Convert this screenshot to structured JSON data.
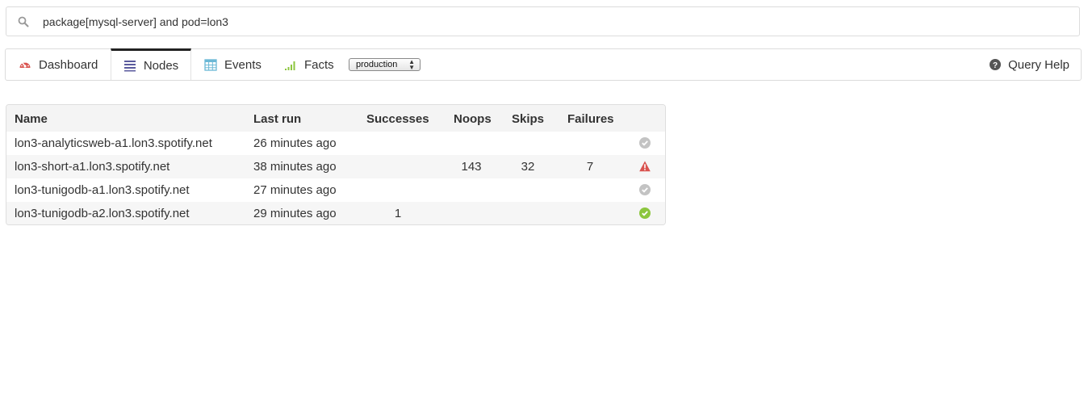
{
  "search": {
    "value": "package[mysql-server] and pod=lon3"
  },
  "nav": {
    "tabs": [
      {
        "label": "Dashboard",
        "icon": "dashboard-icon",
        "active": false
      },
      {
        "label": "Nodes",
        "icon": "list-icon",
        "active": true
      },
      {
        "label": "Events",
        "icon": "calendar-icon",
        "active": false
      },
      {
        "label": "Facts",
        "icon": "bar-chart-icon",
        "active": false
      }
    ],
    "environment": "production",
    "query_help": "Query Help"
  },
  "table": {
    "columns": [
      "Name",
      "Last run",
      "Successes",
      "Noops",
      "Skips",
      "Failures"
    ],
    "rows": [
      {
        "name": "lon3-analyticsweb-a1.lon3.spotify.net",
        "last_run": "26 minutes ago",
        "successes": "",
        "noops": "",
        "skips": "",
        "failures": "",
        "status": "unchanged"
      },
      {
        "name": "lon3-short-a1.lon3.spotify.net",
        "last_run": "38 minutes ago",
        "successes": "",
        "noops": "143",
        "skips": "32",
        "failures": "7",
        "status": "failed"
      },
      {
        "name": "lon3-tunigodb-a1.lon3.spotify.net",
        "last_run": "27 minutes ago",
        "successes": "",
        "noops": "",
        "skips": "",
        "failures": "",
        "status": "unchanged"
      },
      {
        "name": "lon3-tunigodb-a2.lon3.spotify.net",
        "last_run": "29 minutes ago",
        "successes": "1",
        "noops": "",
        "skips": "",
        "failures": "",
        "status": "success"
      }
    ]
  },
  "colors": {
    "dashboard_icon": "#d9534f",
    "list_icon": "#5b5b9e",
    "calendar_icon": "#6bb8d6",
    "chart_icon": "#8dc63f",
    "status_unchanged": "#c3c3c3",
    "status_failed": "#d9534f",
    "status_success": "#8cc63e"
  }
}
